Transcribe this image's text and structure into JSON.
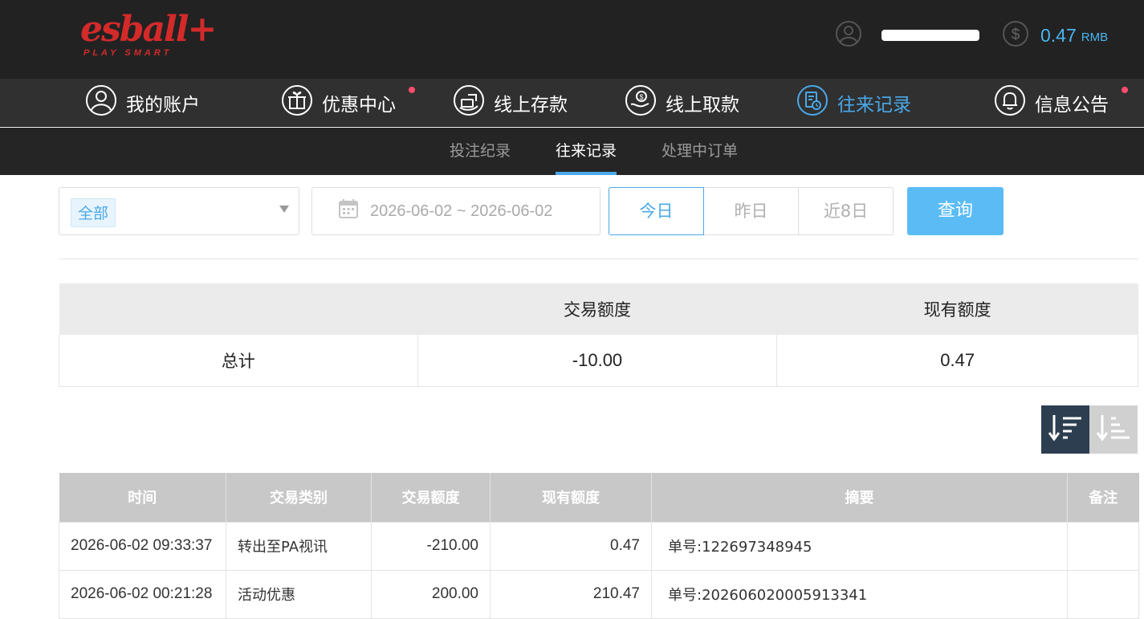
{
  "header": {
    "logo_text": "esball+",
    "logo_tagline": "PLAY SMART",
    "user_icon": "user-circle-icon",
    "balance_icon": "dollar-circle-icon",
    "balance_amount": "0.47",
    "balance_currency": "RMB"
  },
  "colors": {
    "accent": "#4aa8e8",
    "brand_red": "#d42a2a",
    "notify_dot": "#ff4d6d",
    "query_button": "#5bbcf5"
  },
  "main_nav": {
    "items": [
      {
        "label": "我的账户",
        "icon": "user-circle-icon",
        "active": false,
        "dot": false
      },
      {
        "label": "优惠中心",
        "icon": "gift-icon",
        "active": false,
        "dot": true
      },
      {
        "label": "线上存款",
        "icon": "deposit-icon",
        "active": false,
        "dot": false
      },
      {
        "label": "线上取款",
        "icon": "withdraw-icon",
        "active": false,
        "dot": false
      },
      {
        "label": "往来记录",
        "icon": "records-icon",
        "active": true,
        "dot": false
      },
      {
        "label": "信息公告",
        "icon": "bell-icon",
        "active": false,
        "dot": true
      }
    ]
  },
  "sub_nav": {
    "items": [
      {
        "label": "投注纪录",
        "active": false
      },
      {
        "label": "往来记录",
        "active": true
      },
      {
        "label": "处理中订单",
        "active": false
      }
    ]
  },
  "filters": {
    "type_selected": "全部",
    "date_range": "2026-06-02 ~ 2026-06-02",
    "quick": [
      "今日",
      "昨日",
      "近8日"
    ],
    "quick_active": "今日",
    "query_label": "查询"
  },
  "summary": {
    "headers": [
      "",
      "交易额度",
      "现有额度"
    ],
    "row": [
      "总计",
      "-10.00",
      "0.47"
    ]
  },
  "sort": {
    "desc_icon": "sort-descending-icon",
    "asc_icon": "sort-ascending-icon"
  },
  "records": {
    "columns": [
      "时间",
      "交易类别",
      "交易额度",
      "现有额度",
      "摘要",
      "备注"
    ],
    "rows": [
      [
        "2026-06-02 09:33:37",
        "转出至PA视讯",
        "-210.00",
        "0.47",
        "单号:122697348945",
        ""
      ],
      [
        "2026-06-02 00:21:28",
        "活动优惠",
        "200.00",
        "210.47",
        "单号:202606020005913341",
        ""
      ]
    ]
  }
}
